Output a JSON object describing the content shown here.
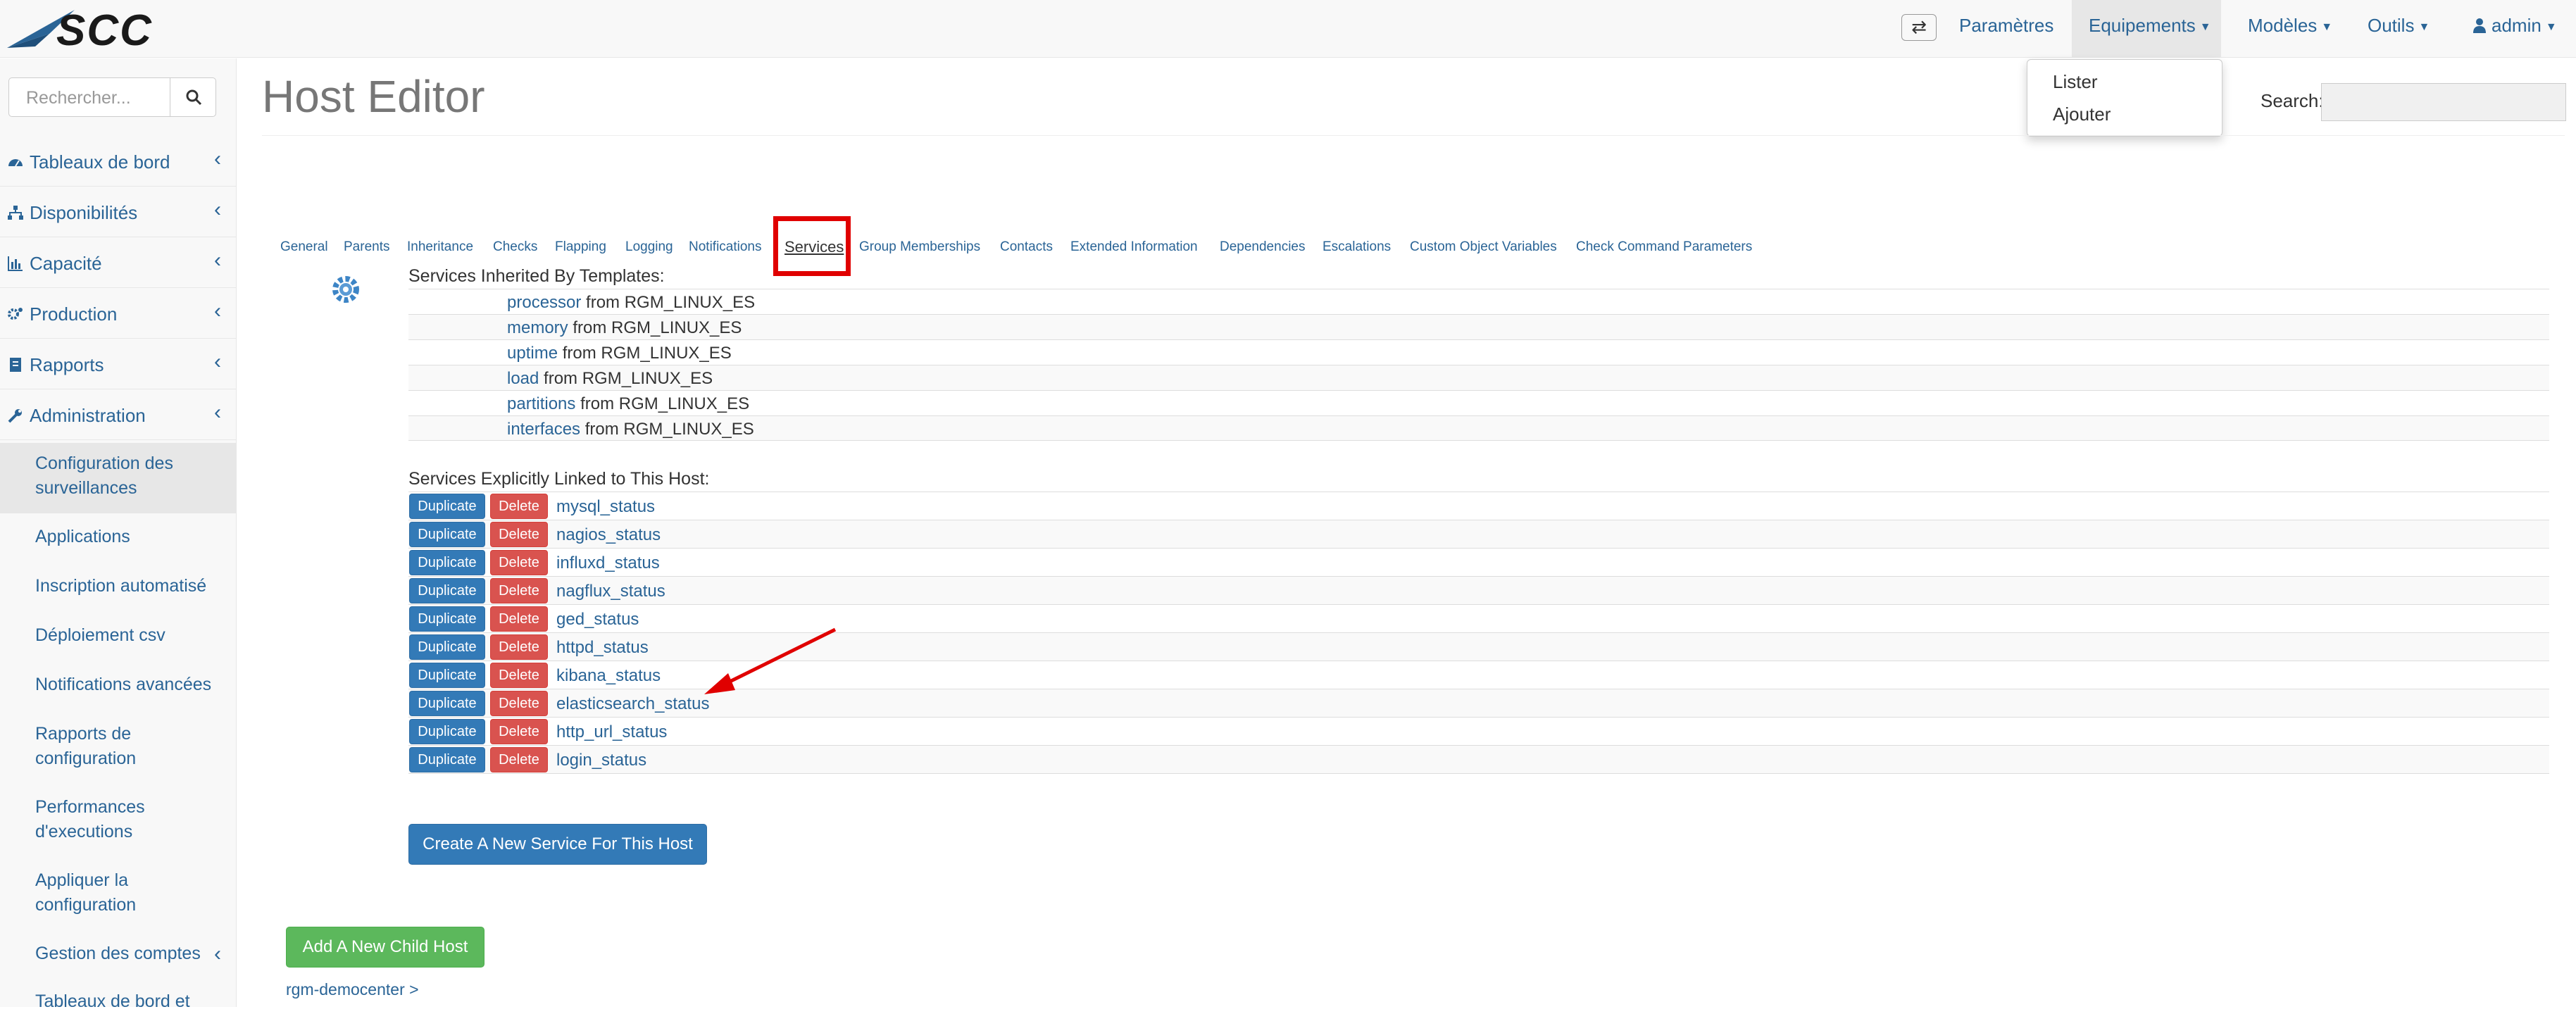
{
  "brand": {
    "logo_text": "SCC",
    "accent": "#2a6496"
  },
  "navbar": {
    "items": [
      {
        "label": "Paramètres",
        "has_caret": false
      },
      {
        "label": "Equipements",
        "has_caret": true
      },
      {
        "label": "Modèles",
        "has_caret": true
      },
      {
        "label": "Outils",
        "has_caret": true
      },
      {
        "label": "admin",
        "has_caret": true,
        "icon": "user-icon"
      }
    ],
    "dropdown": [
      "Lister",
      "Ajouter"
    ]
  },
  "sidebar": {
    "search_placeholder": "Rechercher...",
    "items": [
      {
        "label": "Tableaux de bord",
        "icon": "dashboard-icon"
      },
      {
        "label": "Disponibilités",
        "icon": "sitemap-icon"
      },
      {
        "label": "Capacité",
        "icon": "bar-chart-icon"
      },
      {
        "label": "Production",
        "icon": "cogs-icon"
      },
      {
        "label": "Rapports",
        "icon": "report-icon"
      },
      {
        "label": "Administration",
        "icon": "wrench-icon"
      }
    ],
    "subitems": [
      "Configuration des surveillances",
      "Applications",
      "Inscription automatisé",
      "Déploiement csv",
      "Notifications avancées",
      "Rapports de configuration",
      "Performances d'executions",
      "Appliquer la configuration",
      "Gestion des comptes",
      "Tableaux de bord et"
    ]
  },
  "main": {
    "title": "Host Editor",
    "search_label": "Search:",
    "tabs": [
      "General",
      "Parents",
      "Inheritance",
      "Checks",
      "Flapping",
      "Logging",
      "Notifications",
      "Services",
      "Group Memberships",
      "Contacts",
      "Extended Information",
      "Dependencies",
      "Escalations",
      "Custom Object Variables",
      "Check Command Parameters"
    ],
    "active_tab": "Services",
    "inherited_title": "Services Inherited By Templates:",
    "from_word": "from",
    "inherited": [
      {
        "service": "processor",
        "template": "RGM_LINUX_ES"
      },
      {
        "service": "memory",
        "template": "RGM_LINUX_ES"
      },
      {
        "service": "uptime",
        "template": "RGM_LINUX_ES"
      },
      {
        "service": "load",
        "template": "RGM_LINUX_ES"
      },
      {
        "service": "partitions",
        "template": "RGM_LINUX_ES"
      },
      {
        "service": "interfaces",
        "template": "RGM_LINUX_ES"
      }
    ],
    "linked_title": "Services Explicitly Linked to This Host:",
    "duplicate_label": "Duplicate",
    "delete_label": "Delete",
    "linked": [
      "mysql_status",
      "nagios_status",
      "influxd_status",
      "nagflux_status",
      "ged_status",
      "httpd_status",
      "kibana_status",
      "elasticsearch_status",
      "http_url_status",
      "login_status"
    ],
    "create_button": "Create A New Service For This Host",
    "child_button": "Add A New Child Host",
    "breadcrumb": "rgm-democenter >"
  }
}
